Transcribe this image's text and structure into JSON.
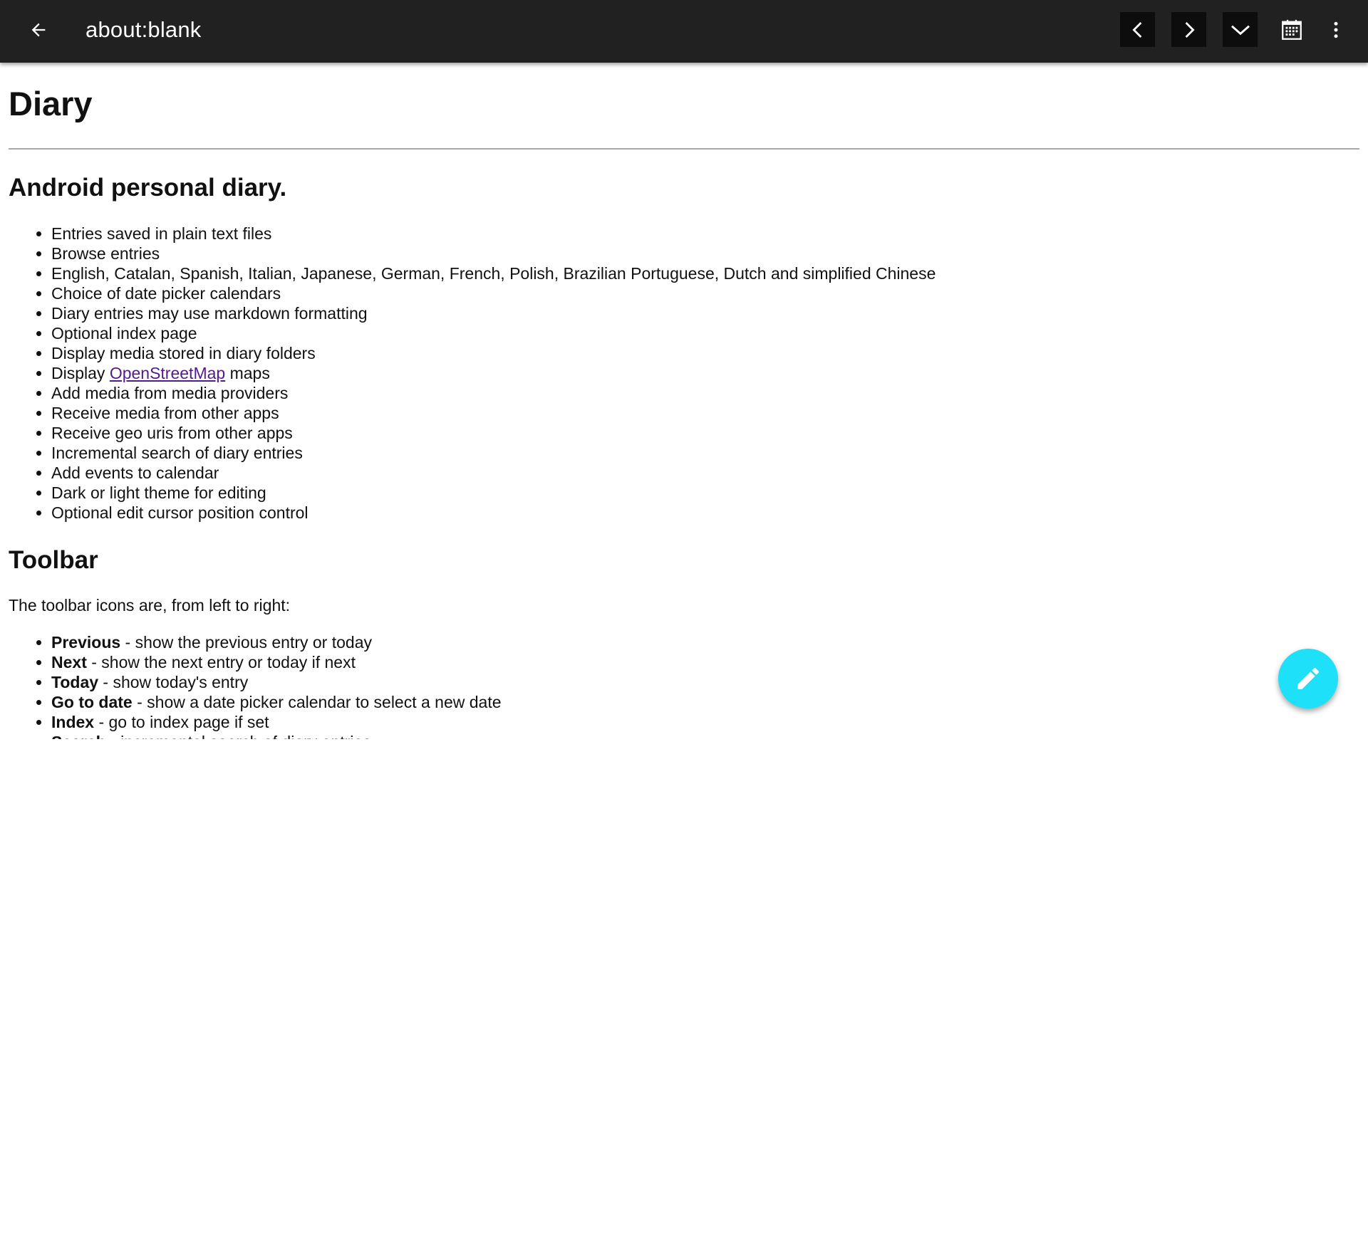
{
  "toolbar": {
    "title": "about:blank",
    "back_icon": "arrow-back-icon",
    "buttons": [
      {
        "name": "previous",
        "icon": "chevron-left-icon"
      },
      {
        "name": "next",
        "icon": "chevron-right-icon"
      },
      {
        "name": "today",
        "icon": "chevron-down-icon"
      },
      {
        "name": "go-to-date",
        "icon": "calendar-icon"
      },
      {
        "name": "overflow-menu",
        "icon": "more-vert-icon"
      }
    ],
    "colors": {
      "background": "#212121",
      "button_bg": "#0d0d0d",
      "icon": "#ffffff"
    }
  },
  "page": {
    "title": "Diary",
    "section1": {
      "heading": "Android personal diary.",
      "items": [
        "Entries saved in plain text files",
        "Browse entries",
        "English, Catalan, Spanish, Italian, Japanese, German, French, Polish, Brazilian Portuguese, Dutch and simplified Chinese",
        "Choice of date picker calendars",
        "Diary entries may use markdown formatting",
        "Optional index page",
        "Display media stored in diary folders",
        {
          "before": "Display ",
          "link": "OpenStreetMap",
          "after": " maps"
        },
        "Add media from media providers",
        "Receive media from other apps",
        "Receive geo uris from other apps",
        "Incremental search of diary entries",
        "Add events to calendar",
        "Dark or light theme for editing",
        "Optional edit cursor position control"
      ]
    },
    "section2": {
      "heading": "Toolbar",
      "intro": "The toolbar icons are, from left to right:",
      "items": [
        {
          "term": "Previous",
          "desc": " - show the previous entry or today"
        },
        {
          "term": "Next",
          "desc": " - show the next entry or today if next"
        },
        {
          "term": "Today",
          "desc": " - show today's entry"
        },
        {
          "term": "Go to date",
          "desc": " - show a date picker calendar to select a new date"
        },
        {
          "term": "Index",
          "desc": " - go to index page if set"
        },
        {
          "term": "Search",
          "desc": " - incremental search of diary entries"
        }
      ]
    }
  },
  "fab": {
    "icon": "pencil-edit-icon",
    "color": "#1ee0f8"
  }
}
